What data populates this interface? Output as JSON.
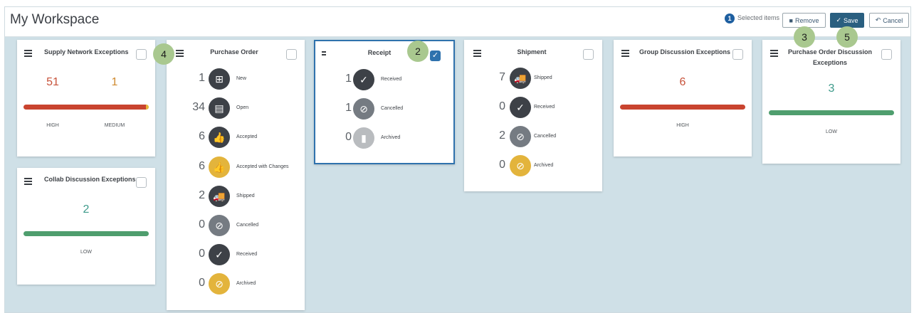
{
  "header": {
    "title": "My Workspace",
    "selected_count": "1",
    "selected_label": "Selected items",
    "remove_label": "Remove",
    "save_label": "Save",
    "cancel_label": "Cancel"
  },
  "callouts": [
    "2",
    "3",
    "4",
    "5"
  ],
  "cards": {
    "supply": {
      "title": "Supply Network Exceptions",
      "high_value": "51",
      "medium_value": "1",
      "high_label": "HIGH",
      "medium_label": "MEDIUM",
      "bar_fraction": {
        "high": 0.98,
        "medium": 0.02
      },
      "colors": {
        "high": "#c9442f",
        "medium": "#e6b53b"
      }
    },
    "collab": {
      "title": "Collab Discussion Exceptions",
      "value": "2",
      "level": "LOW",
      "color": "#4f9e6e"
    },
    "purchase_order": {
      "title": "Purchase Order",
      "rows": [
        {
          "count": "1",
          "label": "New",
          "icon": "new-document-icon",
          "style": "dark"
        },
        {
          "count": "34",
          "label": "Open",
          "icon": "open-document-icon",
          "style": "dark"
        },
        {
          "count": "6",
          "label": "Accepted",
          "icon": "thumbs-up-icon",
          "style": "dark"
        },
        {
          "count": "6",
          "label": "Accepted with Changes",
          "icon": "thumbs-up-icon",
          "style": "yellow"
        },
        {
          "count": "2",
          "label": "Shipped",
          "icon": "truck-icon",
          "style": "dark"
        },
        {
          "count": "0",
          "label": "Cancelled",
          "icon": "cancel-icon",
          "style": "gray"
        },
        {
          "count": "0",
          "label": "Received",
          "icon": "checkmark-icon",
          "style": "dark"
        },
        {
          "count": "0",
          "label": "Archived",
          "icon": "cancel-icon",
          "style": "yellow"
        }
      ]
    },
    "receipt": {
      "title": "Receipt",
      "rows": [
        {
          "count": "1",
          "label": "Received",
          "icon": "checkmark-icon",
          "style": "dark"
        },
        {
          "count": "1",
          "label": "Cancelled",
          "icon": "cancel-icon",
          "style": "gray"
        },
        {
          "count": "0",
          "label": "Archived",
          "icon": "archive-icon",
          "style": "light"
        }
      ]
    },
    "shipment": {
      "title": "Shipment",
      "rows": [
        {
          "count": "7",
          "label": "Shipped",
          "icon": "truck-icon",
          "style": "dark"
        },
        {
          "count": "0",
          "label": "Received",
          "icon": "checkmark-icon",
          "style": "dark"
        },
        {
          "count": "2",
          "label": "Cancelled",
          "icon": "cancel-icon",
          "style": "gray"
        },
        {
          "count": "0",
          "label": "Archived",
          "icon": "cancel-icon",
          "style": "yellow"
        }
      ]
    },
    "group": {
      "title": "Group Discussion Exceptions",
      "value": "6",
      "level": "HIGH",
      "color": "#c9442f"
    },
    "po_discussion": {
      "title": "Purchase Order Discussion Exceptions",
      "value": "3",
      "level": "LOW",
      "color": "#4f9e6e"
    }
  }
}
